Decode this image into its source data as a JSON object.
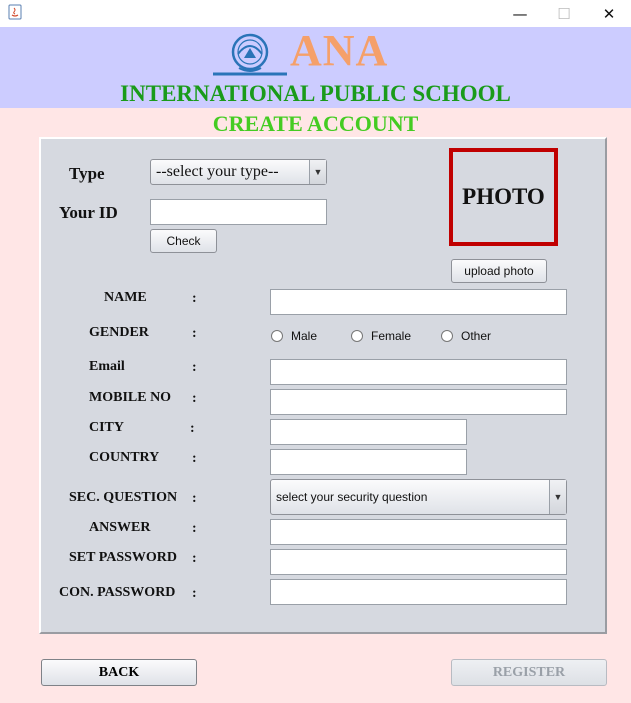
{
  "window": {
    "minimize": "—",
    "maximize": "☐",
    "close": "✕"
  },
  "header": {
    "brand": "ANA",
    "school": "INTERNATIONAL PUBLIC SCHOOL"
  },
  "page_title": "CREATE ACCOUNT",
  "top": {
    "type_label": "Type",
    "type_value": "--select your type--",
    "id_label": "Your ID",
    "id_value": "",
    "check_button": "Check",
    "photo_label": "PHOTO",
    "upload_button": "upload photo"
  },
  "form": {
    "colon": ":",
    "name_label": "NAME",
    "name_value": "",
    "gender_label": "GENDER",
    "gender_options": [
      "Male",
      "Female",
      "Other"
    ],
    "email_label": "Email",
    "email_value": "",
    "mobile_label": "MOBILE NO",
    "mobile_value": "",
    "city_label": "CITY",
    "city_value": "",
    "country_label": "COUNTRY",
    "country_value": "",
    "secq_label": "SEC. QUESTION",
    "secq_value": "select your security question",
    "answer_label": "ANSWER",
    "answer_value": "",
    "setpw_label": "SET PASSWORD",
    "setpw_value": "",
    "conpw_label": "CON. PASSWORD",
    "conpw_value": ""
  },
  "footer": {
    "back_button": "BACK",
    "register_button": "REGISTER"
  },
  "colors": {
    "header_bg": "#ccccff",
    "body_bg": "#ffe6e6",
    "brand": "#f5a06a",
    "school": "#1a9b1a",
    "title": "#44cc22",
    "photo_border": "#c00000"
  }
}
